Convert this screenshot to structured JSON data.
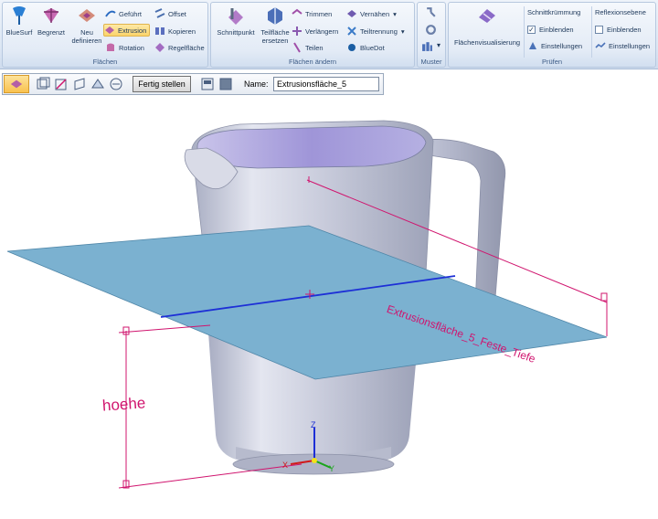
{
  "ribbon": {
    "groups": {
      "flaechen": "Flächen",
      "flaechen_aendern": "Flächen ändern",
      "muster": "Muster",
      "pruefen": "Prüfen"
    },
    "flaechen": {
      "bluesurf": "BlueSurf",
      "begrenzt": "Begrenzt",
      "neu_line1": "Neu",
      "neu_line2": "definieren",
      "gefuehrt": "Geführt",
      "extrusion": "Extrusion",
      "rotation": "Rotation",
      "offset": "Offset",
      "kopieren": "Kopieren",
      "regelflaeche": "Regelfläche"
    },
    "flaechen_aendern": {
      "schnittpunkt": "Schnittpunkt",
      "teilflaeche_line1": "Teilfläche",
      "teilflaeche_line2": "ersetzen",
      "trimmen": "Trimmen",
      "verlaengern": "Verlängern",
      "teilen": "Teilen",
      "vernaehen": "Vernähen",
      "teiltrennung": "Teiltrennung",
      "bluedot": "BlueDot"
    },
    "pruefen": {
      "flaechenvisualisierung": "Flächenvisualisierung",
      "schnittkruemmung": "Schnittkrümmung",
      "einblenden1": "Einblenden",
      "einstellungen1": "Einstellungen",
      "reflexionsebene": "Reflexionsebene",
      "einblenden2": "Einblenden",
      "einstellungen2": "Einstellungen",
      "checkmark": "✓"
    },
    "accent_color": "#fbd46b"
  },
  "commandbar": {
    "finish_label": "Fertig stellen",
    "name_label": "Name:",
    "name_value": "Extrusionsfläche_5"
  },
  "viewport": {
    "dim_height_label": "hoehe",
    "dim_depth_label": "Extrusionsfläche_5_Feste_Tiefe",
    "axis_z": "Z",
    "axis_x": "X",
    "axis_y": "Y",
    "dimension_color": "#d0146e",
    "plane_color": "#7bb1d0"
  }
}
